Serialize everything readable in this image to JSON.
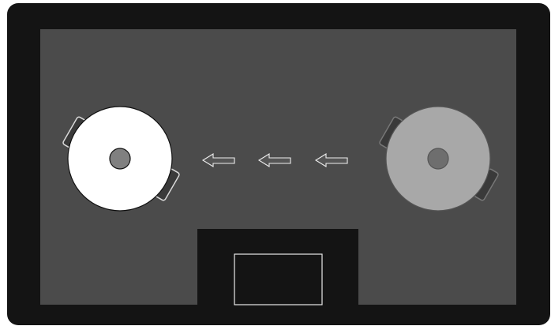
{
  "diagram": {
    "kind": "induction-hob-pan-transfer",
    "colors": {
      "outer_frame": "#141414",
      "surface": "#4b4b4b",
      "control_notch": "#141414",
      "control_panel_outline": "#e8e8e8",
      "pan_active_fill": "#ffffff",
      "pan_active_stroke": "#111111",
      "pan_inactive_fill": "#a8a8a8",
      "pan_inactive_stroke": "#555555",
      "pan_knob_active": "#808080",
      "pan_knob_inactive": "#6e6e6e",
      "handle_active_fill": "#3a3a3a",
      "handle_active_stroke": "#d9d9d9",
      "handle_inactive_fill": "#3a3a3a",
      "handle_inactive_stroke": "#777777",
      "arrow_fill": "#555555",
      "arrow_stroke": "#eeeeee"
    },
    "pans": [
      {
        "name": "pan-left",
        "state": "active",
        "handles": 2
      },
      {
        "name": "pan-right",
        "state": "inactive",
        "handles": 2
      }
    ],
    "arrows": {
      "count": 3,
      "direction": "left"
    },
    "control_panel": {
      "shape": "rectangle",
      "label": ""
    }
  }
}
